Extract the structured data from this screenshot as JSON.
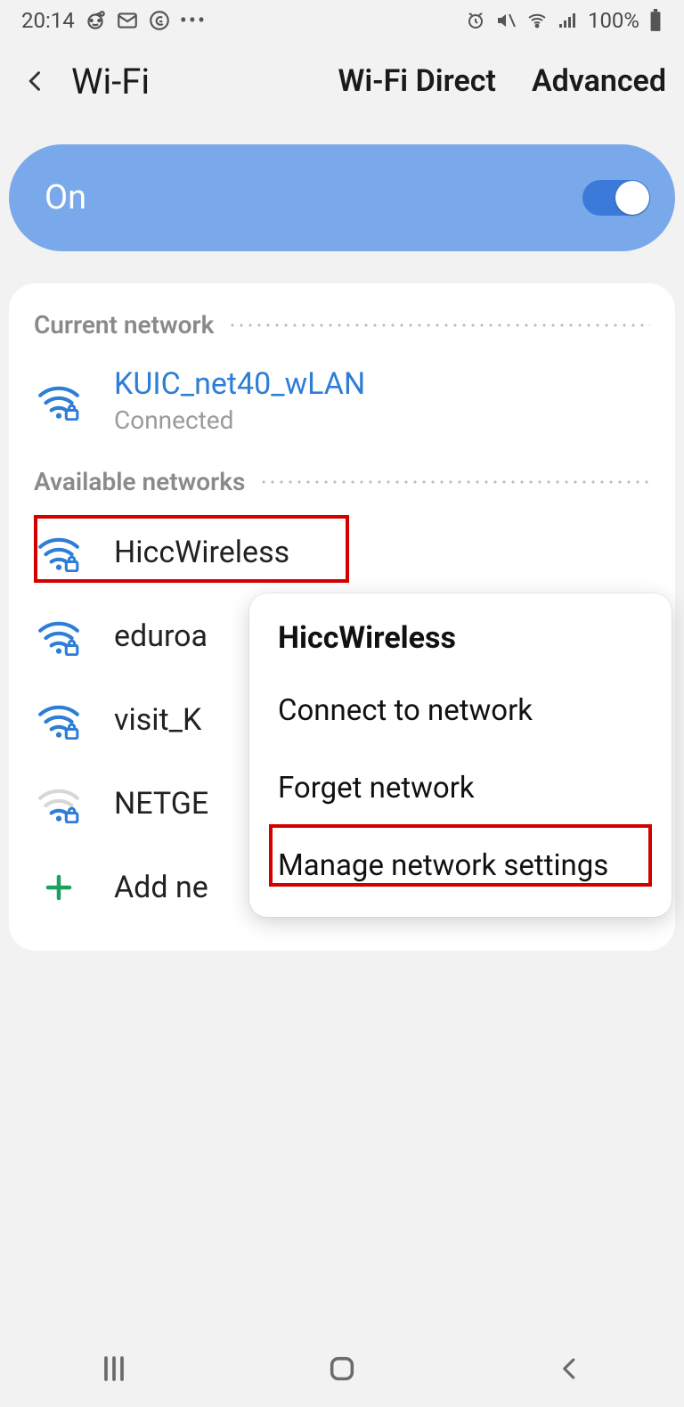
{
  "statusbar": {
    "time": "20:14",
    "battery_pct": "100%"
  },
  "header": {
    "title": "Wi-Fi",
    "link_direct": "Wi-Fi Direct",
    "link_advanced": "Advanced"
  },
  "toggle": {
    "state_label": "On",
    "enabled": true
  },
  "sections": {
    "current_label": "Current network",
    "available_label": "Available networks"
  },
  "current_network": {
    "ssid": "KUIC_net40_wLAN",
    "status": "Connected"
  },
  "available_networks": [
    {
      "ssid": "HiccWireless",
      "secured": true,
      "strength": "strong"
    },
    {
      "ssid": "eduroam",
      "secured": true,
      "strength": "strong",
      "truncated": "eduroa"
    },
    {
      "ssid": "visit_KU",
      "secured": true,
      "strength": "strong",
      "truncated": "visit_K"
    },
    {
      "ssid": "NETGEAR",
      "secured": true,
      "strength": "weak",
      "truncated": "NETGE"
    }
  ],
  "add_network_label": "Add network",
  "add_network_truncated": "Add ne",
  "popup": {
    "title": "HiccWireless",
    "items": [
      "Connect to network",
      "Forget network",
      "Manage network settings"
    ]
  }
}
